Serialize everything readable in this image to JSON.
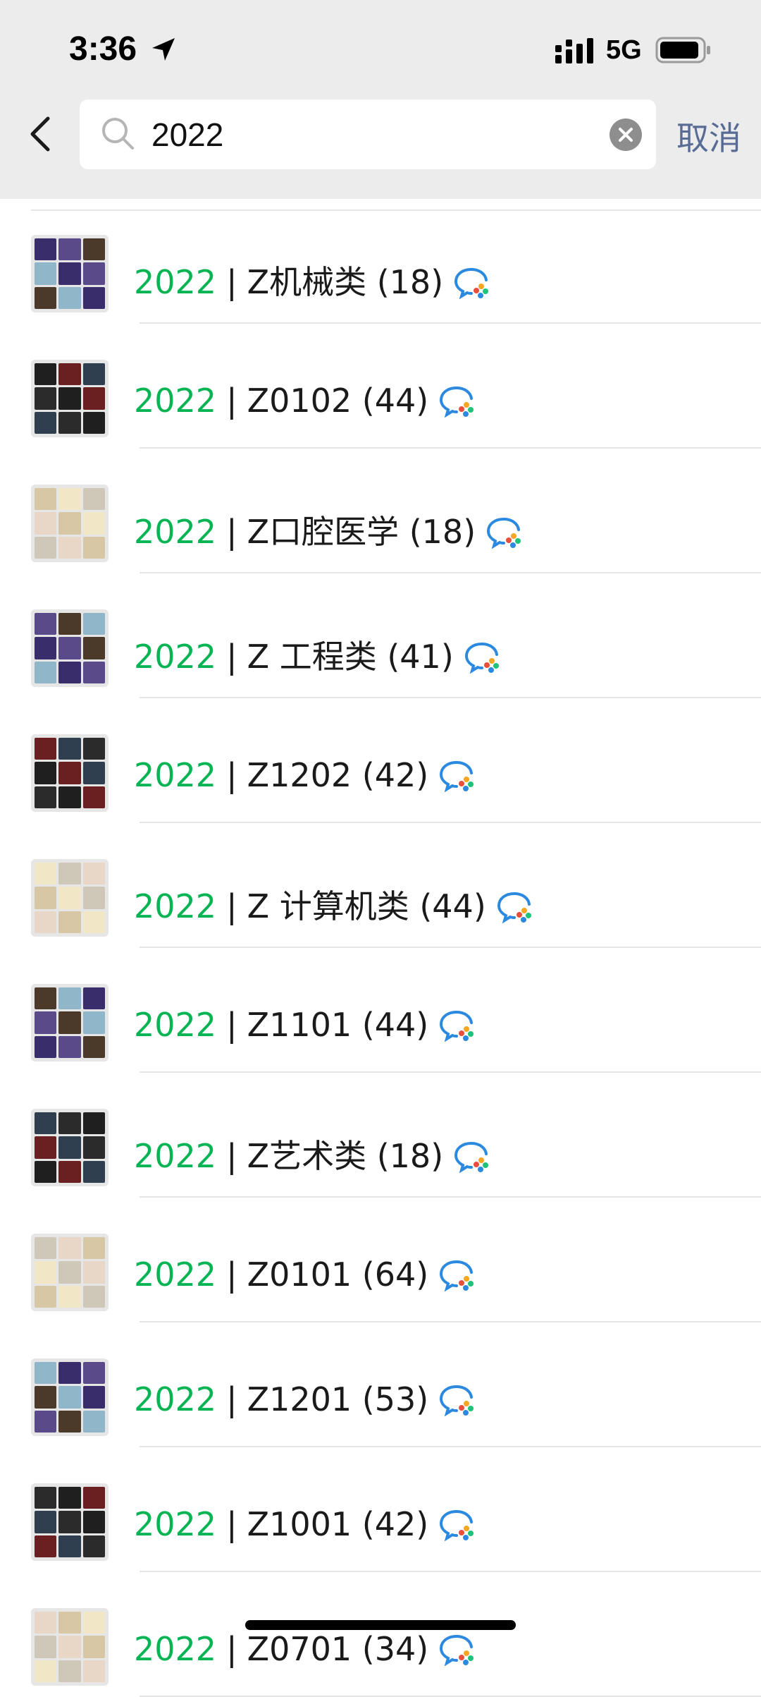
{
  "status_bar": {
    "time": "3:36",
    "network": "5G",
    "icons": [
      "location-arrow-icon",
      "signal-icon",
      "battery-icon"
    ]
  },
  "search": {
    "query": "2022",
    "cancel_label": "取消",
    "icons": [
      "back-icon",
      "search-icon",
      "clear-icon"
    ]
  },
  "colors": {
    "highlight": "#07b454",
    "cancel": "#576b95",
    "topbar_bg": "#ececec"
  },
  "results": [
    {
      "highlight": "2022",
      "separator": "|",
      "name": "Z机械类 (18)"
    },
    {
      "highlight": "2022",
      "separator": "|",
      "name": "Z0102 (44)"
    },
    {
      "highlight": "2022",
      "separator": "|",
      "name": "Z口腔医学 (18)"
    },
    {
      "highlight": "2022",
      "separator": "|",
      "name": "Z 工程类 (41)"
    },
    {
      "highlight": "2022",
      "separator": "|",
      "name": "Z1202 (42)"
    },
    {
      "highlight": "2022",
      "separator": "|",
      "name": "Z 计算机类 (44)"
    },
    {
      "highlight": "2022",
      "separator": "|",
      "name": "Z1101 (44)"
    },
    {
      "highlight": "2022",
      "separator": "|",
      "name": "Z艺术类 (18)"
    },
    {
      "highlight": "2022",
      "separator": "|",
      "name": "Z0101 (64)"
    },
    {
      "highlight": "2022",
      "separator": "|",
      "name": "Z1201 (53)"
    },
    {
      "highlight": "2022",
      "separator": "|",
      "name": "Z1001 (42)"
    },
    {
      "highlight": "2022",
      "separator": "|",
      "name": "Z0701 (34)"
    }
  ]
}
